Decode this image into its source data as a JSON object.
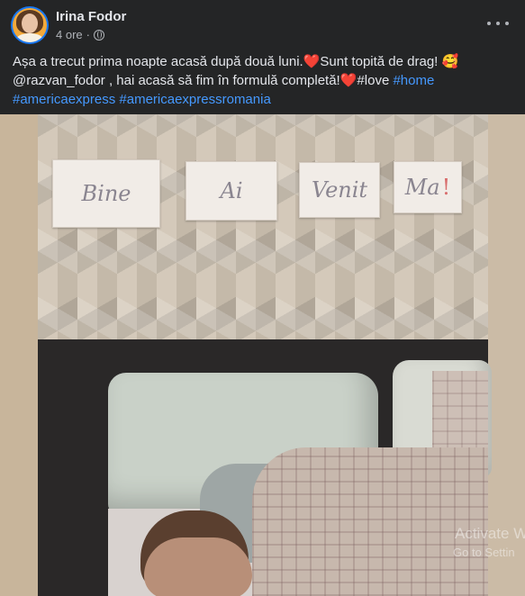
{
  "post": {
    "author": "Irina Fodor",
    "time": "4 ore",
    "privacy_icon": "globe-icon",
    "more_icon": "more-horizontal-icon",
    "caption": {
      "line1_text": "Așa a trecut prima noapte acasă după două luni.",
      "line1_text2": "Sunt topită de drag! ",
      "emoji_heart": "❤️",
      "emoji_love": "🥰",
      "line2_text": "@razvan_fodor , hai acasă să fim în formulă completă!",
      "line2_text2": "#love ",
      "hashtag_home": "#home",
      "hashtag_amex": "#americaexpress",
      "hashtag_amex_ro": "#americaexpressromania"
    }
  },
  "photo": {
    "signs": [
      "Bine",
      "Ai",
      "Venit",
      "Ma"
    ],
    "sign_mark": "!"
  },
  "windows_watermark": {
    "title": "Activate W",
    "subtitle": "Go to Settin"
  },
  "colors": {
    "background": "#242526",
    "link": "#4599ff",
    "text": "#e4e6eb",
    "secondary_text": "#b0b3b8"
  }
}
